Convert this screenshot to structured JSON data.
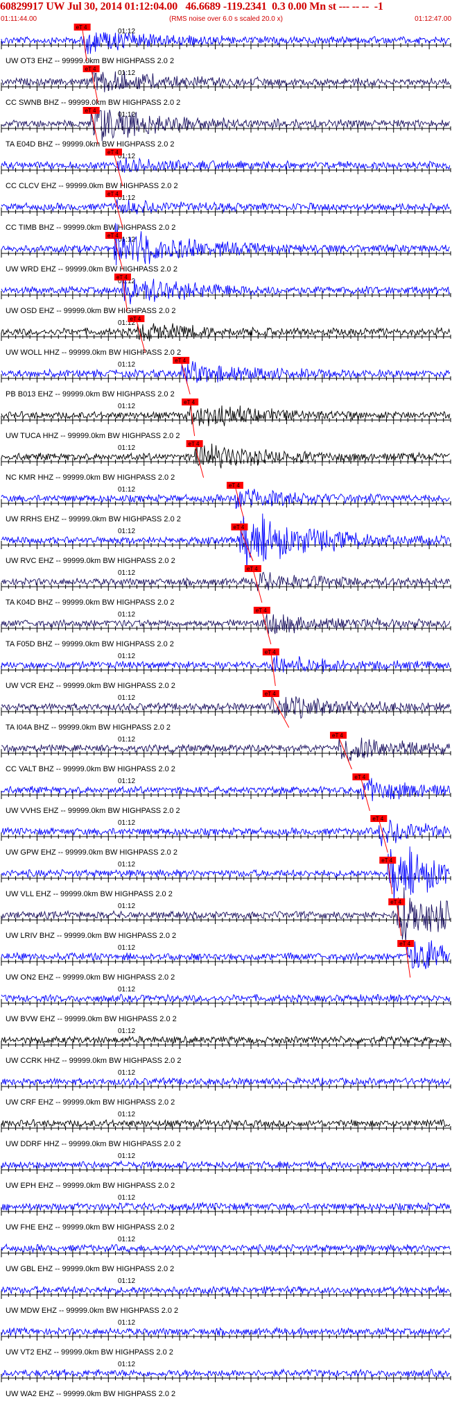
{
  "header": {
    "title": "60829917 UW Jul 30, 2014 01:12:04.00   46.6689 -119.2341  0.3 0.00 Mn st --- -- --  -1",
    "start_time": "01:11:44.00",
    "scale_note": "(RMS noise over 6.0 s scaled 20.0 x)",
    "end_time": "01:12:47.00"
  },
  "minute_tick_label": "01:12",
  "pick_label": "eT 4",
  "colors": {
    "header_text": "#d00000",
    "pick": "#ff0000",
    "trace_blue": "#0000ff",
    "trace_navy": "#1a1060",
    "trace_black": "#000000"
  },
  "traces": [
    {
      "label": "UW OT3 EHZ -- 99999.0km BW  HIGHPASS  2.0  2",
      "color": "blue",
      "pick": 0.18,
      "pick_end": 0.19,
      "amp": 0.3
    },
    {
      "label": "CC SWNB BHZ -- 99999.0km BW  HIGHPASS  2.0  2",
      "color": "navy",
      "pick": 0.2,
      "pick_end": 0.215,
      "amp": 0.3
    },
    {
      "label": "TA E04D BHZ -- 99999.0km BW  HIGHPASS  2.0  2",
      "color": "navy",
      "pick": 0.2,
      "pick_end": 0.215,
      "amp": 0.5
    },
    {
      "label": "CC CLCV EHZ -- 99999.0km BW  HIGHPASS  2.0  2",
      "color": "blue",
      "pick": 0.25,
      "pick_end": 0.27,
      "amp": 0.15
    },
    {
      "label": "CC TIMB BHZ -- 99999.0km BW  HIGHPASS  2.0  2",
      "color": "blue",
      "pick": 0.25,
      "pick_end": 0.27,
      "amp": 0.15
    },
    {
      "label": "UW WRD EHZ -- 99999.0km BW  HIGHPASS  2.0  2",
      "color": "blue",
      "pick": 0.25,
      "pick_end": 0.27,
      "amp": 0.6
    },
    {
      "label": "UW OSD EHZ -- 99999.0km BW  HIGHPASS  2.0  2",
      "color": "blue",
      "pick": 0.27,
      "pick_end": 0.28,
      "amp": 0.4
    },
    {
      "label": "UW WOLL HHZ -- 99999.0km BW  HIGHPASS  2.0  2",
      "color": "black",
      "pick": 0.3,
      "pick_end": 0.32,
      "amp": 0.2
    },
    {
      "label": "PB B013 EHZ -- 99999.0km BW  HIGHPASS  2.0  2",
      "color": "blue",
      "pick": 0.4,
      "pick_end": 0.42,
      "amp": 0.3
    },
    {
      "label": "UW TUCA HHZ -- 99999.0km BW  HIGHPASS  2.0  2",
      "color": "black",
      "pick": 0.42,
      "pick_end": 0.43,
      "amp": 0.3
    },
    {
      "label": "NC KMR HHZ -- 99999.0km BW  HIGHPASS  2.0  2",
      "color": "black",
      "pick": 0.43,
      "pick_end": 0.45,
      "amp": 0.35
    },
    {
      "label": "UW RRHS EHZ -- 99999.0km BW  HIGHPASS  2.0  2",
      "color": "blue",
      "pick": 0.52,
      "pick_end": 0.54,
      "amp": 0.25
    },
    {
      "label": "UW RVC EHZ -- 99999.0km BW  HIGHPASS  2.0  2",
      "color": "blue",
      "pick": 0.53,
      "pick_end": 0.56,
      "amp": 0.8
    },
    {
      "label": "TA K04D BHZ -- 99999.0km BW  HIGHPASS  2.0  2",
      "color": "navy",
      "pick": 0.56,
      "pick_end": 0.58,
      "amp": 0.2
    },
    {
      "label": "TA F05D BHZ -- 99999.0km BW  HIGHPASS  2.0  2",
      "color": "navy",
      "pick": 0.58,
      "pick_end": 0.6,
      "amp": 0.25
    },
    {
      "label": "UW VCR EHZ -- 99999.0km BW  HIGHPASS  2.0  2",
      "color": "blue",
      "pick": 0.6,
      "pick_end": 0.61,
      "amp": 0.2
    },
    {
      "label": "TA I04A BHZ -- 99999.0km BW  HIGHPASS  2.0  2",
      "color": "navy",
      "pick": 0.6,
      "pick_end": 0.64,
      "amp": 0.3
    },
    {
      "label": "CC VALT BHZ -- 99999.0km BW  HIGHPASS  2.0  2",
      "color": "navy",
      "pick": 0.75,
      "pick_end": 0.78,
      "amp": 0.4
    },
    {
      "label": "UW VVHS EHZ -- 99999.0km BW  HIGHPASS  2.0  2",
      "color": "blue",
      "pick": 0.8,
      "pick_end": 0.82,
      "amp": 0.3
    },
    {
      "label": "UW GPW EHZ -- 99999.0km BW  HIGHPASS  2.0  2",
      "color": "blue",
      "pick": 0.84,
      "pick_end": 0.86,
      "amp": 0.3
    },
    {
      "label": "UW VLL EHZ -- 99999.0km BW  HIGHPASS  2.0  2",
      "color": "blue",
      "pick": 0.86,
      "pick_end": 0.87,
      "amp": 0.8
    },
    {
      "label": "UW LRIV BHZ -- 99999.0km BW  HIGHPASS  2.0  2",
      "color": "navy",
      "pick": 0.88,
      "pick_end": 0.89,
      "amp": 0.7
    },
    {
      "label": "UW ON2 EHZ -- 99999.0km BW  HIGHPASS  2.0  2",
      "color": "blue",
      "pick": 0.9,
      "pick_end": 0.91,
      "amp": 0.5
    },
    {
      "label": "UW BVW EHZ -- 99999.0km BW  HIGHPASS  2.0  2",
      "color": "blue",
      "amp": 0.1
    },
    {
      "label": "UW CCRK HHZ -- 99999.0km BW  HIGHPASS  2.0  2",
      "color": "black",
      "amp": 0.15
    },
    {
      "label": "UW CRF EHZ -- 99999.0km BW  HIGHPASS  2.0  2",
      "color": "blue",
      "amp": 0.1
    },
    {
      "label": "UW DDRF HHZ -- 99999.0km BW  HIGHPASS  2.0  2",
      "color": "black",
      "amp": 0.2
    },
    {
      "label": "UW EPH EHZ -- 99999.0km BW  HIGHPASS  2.0  2",
      "color": "blue",
      "amp": 0.1
    },
    {
      "label": "UW FHE EHZ -- 99999.0km BW  HIGHPASS  2.0  2",
      "color": "blue",
      "amp": 0.1
    },
    {
      "label": "UW GBL EHZ -- 99999.0km BW  HIGHPASS  2.0  2",
      "color": "blue",
      "amp": 0.1
    },
    {
      "label": "UW MDW EHZ -- 99999.0km BW  HIGHPASS  2.0  2",
      "color": "blue",
      "amp": 0.1
    },
    {
      "label": "UW VT2 EHZ -- 99999.0km BW  HIGHPASS  2.0  2",
      "color": "blue",
      "amp": 0.1
    },
    {
      "label": "UW WA2 EHZ -- 99999.0km BW  HIGHPASS  2.0  2",
      "color": "blue",
      "amp": 0.2
    }
  ]
}
